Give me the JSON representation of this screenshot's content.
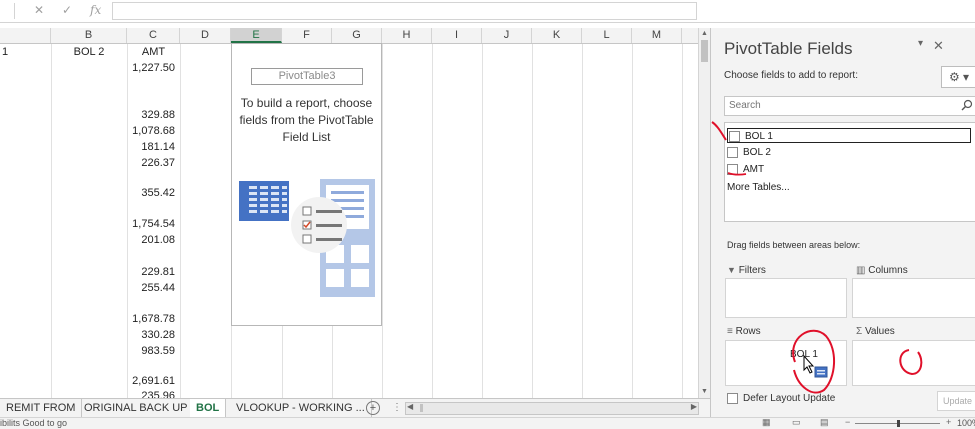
{
  "formula_bar": {
    "cancel_glyph": "✕",
    "enter_glyph": "✓",
    "fx_label": "fx"
  },
  "columns": [
    "",
    "B",
    "C",
    "D",
    "E",
    "F",
    "G",
    "H",
    "I",
    "J",
    "K",
    "L",
    "M"
  ],
  "header_row": {
    "a": "1",
    "b": "BOL 2",
    "c": "AMT"
  },
  "amounts": [
    "1,227.50",
    "329.88",
    "1,078.68",
    "181.14",
    "226.37",
    "355.42",
    "1,754.54",
    "201.08",
    "229.81",
    "255.44",
    "1,678.78",
    "330.28",
    "983.59",
    "2,691.61",
    "235.96"
  ],
  "pivot_placeholder": {
    "name": "PivotTable3",
    "message": "To build a report, choose fields from the PivotTable Field List"
  },
  "sheet_tabs": [
    "REMIT FROM",
    "ORIGINAL BACK UP",
    "BOL",
    "VLOOKUP - WORKING ..."
  ],
  "active_tab": "BOL",
  "status_text": "ibilits Good to go",
  "zoom": "100%",
  "pane": {
    "title": "PivotTable Fields",
    "subtitle": "Choose fields to add to report:",
    "search_placeholder": "Search",
    "fields": [
      {
        "label": "BOL 1",
        "checked": false
      },
      {
        "label": "BOL 2",
        "checked": false
      },
      {
        "label": "AMT",
        "checked": false
      }
    ],
    "more_tables": "More Tables...",
    "drag_label": "Drag fields between areas below:",
    "areas": {
      "filters": "Filters",
      "columns": "Columns",
      "rows": "Rows",
      "values": "Values"
    },
    "rows_item": "BOL 1",
    "defer_label": "Defer Layout Update",
    "update_label": "Update"
  },
  "colors": {
    "excel_green": "#217346",
    "annotation_red": "#e0102a"
  },
  "icons": [
    "cancel-icon",
    "enter-icon",
    "fx-icon",
    "gear-icon",
    "close-icon",
    "search-icon",
    "filter-icon",
    "columns-icon",
    "rows-icon",
    "values-sigma-icon",
    "add-sheet-icon"
  ]
}
